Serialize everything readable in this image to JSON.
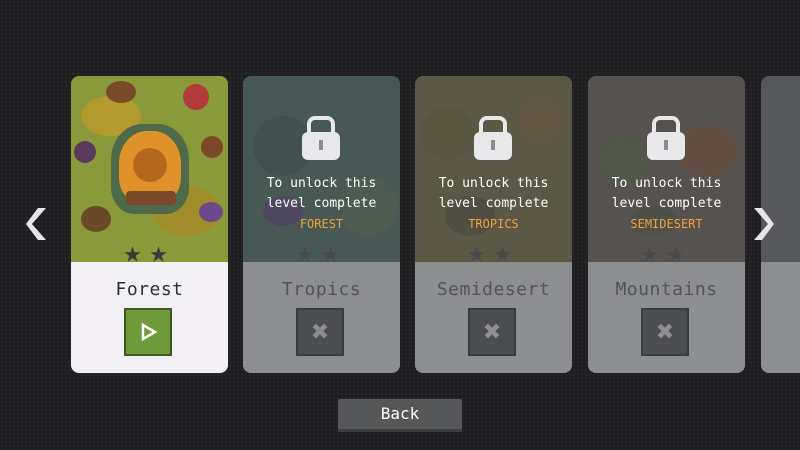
{
  "levels": [
    {
      "name": "Forest",
      "status": "unlocked",
      "stars": "★★"
    },
    {
      "name": "Tropics",
      "status": "locked",
      "stars": "★★",
      "unlock_line1": "To unlock this",
      "unlock_line2": "level complete",
      "requirement": "FOREST"
    },
    {
      "name": "Semidesert",
      "status": "locked",
      "stars": "★★",
      "unlock_line1": "To unlock this",
      "unlock_line2": "level complete",
      "requirement": "TROPICS"
    },
    {
      "name": "Mountains",
      "status": "locked",
      "stars": "★★",
      "unlock_line1": "To unlock this",
      "unlock_line2": "level complete",
      "requirement": "SEMIDESERT"
    }
  ],
  "back_label": "Back",
  "colors": {
    "play": "#6f9a3c",
    "requirement": "#f0a23a",
    "locked_panel": "#8d8e90"
  },
  "icons": {
    "play": "play-icon",
    "lock": "lock-icon",
    "close": "close-icon",
    "prev": "chevron-left-icon",
    "next": "chevron-right-icon",
    "star": "star-icon"
  }
}
